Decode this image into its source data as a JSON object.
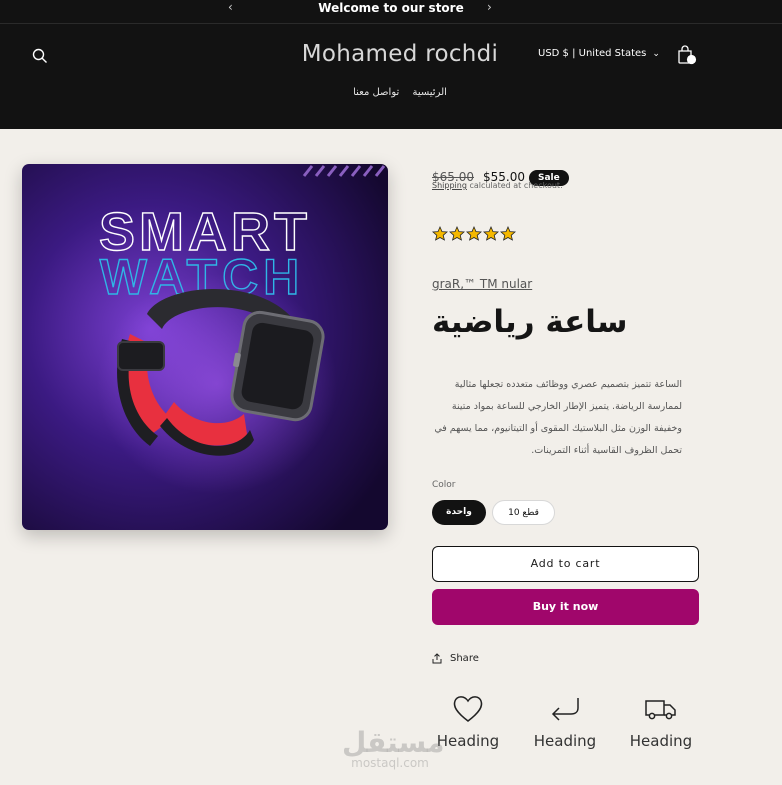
{
  "announcement": {
    "text": "Welcome to our store",
    "prev_icon": "chevron-left-icon",
    "next_icon": "chevron-right-icon"
  },
  "header": {
    "logo": "Mohamed rochdi",
    "nav": [
      "تواصل معنا",
      "الرئيسية"
    ],
    "currency": "USD $ | United States",
    "search_icon": "search-icon",
    "cart_icon": "shopping-bag-icon"
  },
  "hero_image": {
    "line1": "SMART",
    "line2": "WATCH"
  },
  "product": {
    "price_old": "$65.00",
    "price_new": "$55.00",
    "badge": "Sale",
    "shipping_link": "Shipping",
    "shipping_rest": "calculated at checkout.",
    "rating": 5,
    "rating_max": 5,
    "vendor": "graR,™ TM nular",
    "title": "ساعة رياضية",
    "description": "الساعة تتميز بتصميم عصري ووظائف متعدده تجعلها مثالية لممارسة الرياضة. يتميز الإطار الخارجي للساعة بمواد متينة وخفيفة الوزن مثل البلاستيك المقوى أو التيتانيوم، مما يسهم في تحمل الظروف القاسية أثناء التمرينات.",
    "color_label": "Color",
    "options": [
      "واحدة",
      "قطع 10"
    ],
    "selected_option": "واحدة",
    "add_to_cart": "Add to cart",
    "buy_now": "Buy it now",
    "share": "Share"
  },
  "features": [
    {
      "icon": "heart-icon",
      "label": "Heading"
    },
    {
      "icon": "return-arrow-icon",
      "label": "Heading"
    },
    {
      "icon": "delivery-truck-icon",
      "label": "Heading"
    }
  ],
  "watermark": {
    "arabic": "مستقل",
    "latin": "mostaql.com"
  },
  "colors": {
    "header_bg": "#121212",
    "page_bg": "#f2efea",
    "buy_button": "#a0066b",
    "hero_bg": "#2a0f5e",
    "strap": "#e8303f"
  }
}
